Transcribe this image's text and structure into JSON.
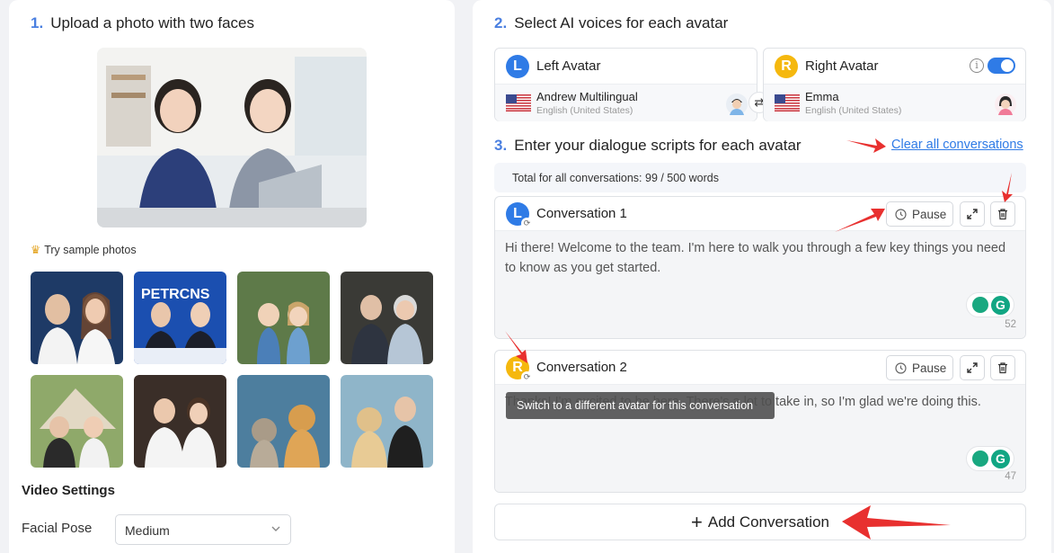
{
  "upload": {
    "step": "1.",
    "title": "Upload a photo with two faces",
    "sample_label": "Try sample photos",
    "samples": [
      "sample-photo-1",
      "sample-photo-2",
      "sample-photo-3",
      "sample-photo-4",
      "sample-photo-5",
      "sample-photo-6",
      "sample-photo-7",
      "sample-photo-8"
    ]
  },
  "video_settings": {
    "title": "Video Settings",
    "facial_pose_label": "Facial Pose",
    "facial_pose_value": "Medium"
  },
  "voices": {
    "step": "2.",
    "title": "Select AI voices for each avatar",
    "left": {
      "badge": "L",
      "name": "Left Avatar",
      "voice": "Andrew Multilingual",
      "locale": "English (United States)",
      "color": "#2f7be6"
    },
    "right": {
      "badge": "R",
      "name": "Right Avatar",
      "voice": "Emma",
      "locale": "English (United States)",
      "color": "#f5b80e"
    },
    "swap_icon": "⇄",
    "toggle_on": true
  },
  "scripts": {
    "step": "3.",
    "title": "Enter your dialogue scripts for each avatar",
    "clear_label": "Clear all conversations",
    "total_label": "Total for all conversations: 99 / 500 words",
    "conversations": [
      {
        "badge": "L",
        "title": "Conversation 1",
        "pause_label": "Pause",
        "text": "Hi there! Welcome to the team. I'm here to walk you through a few key things you need to know as you get started.",
        "count": "52"
      },
      {
        "badge": "R",
        "title": "Conversation 2",
        "pause_label": "Pause",
        "text": "Thanks! I'm excited to be here. There's a lot to take in, so I'm glad we're doing this.",
        "count": "47"
      }
    ],
    "tooltip": "Switch to a different avatar for this conversation",
    "add_label": "Add Conversation"
  }
}
